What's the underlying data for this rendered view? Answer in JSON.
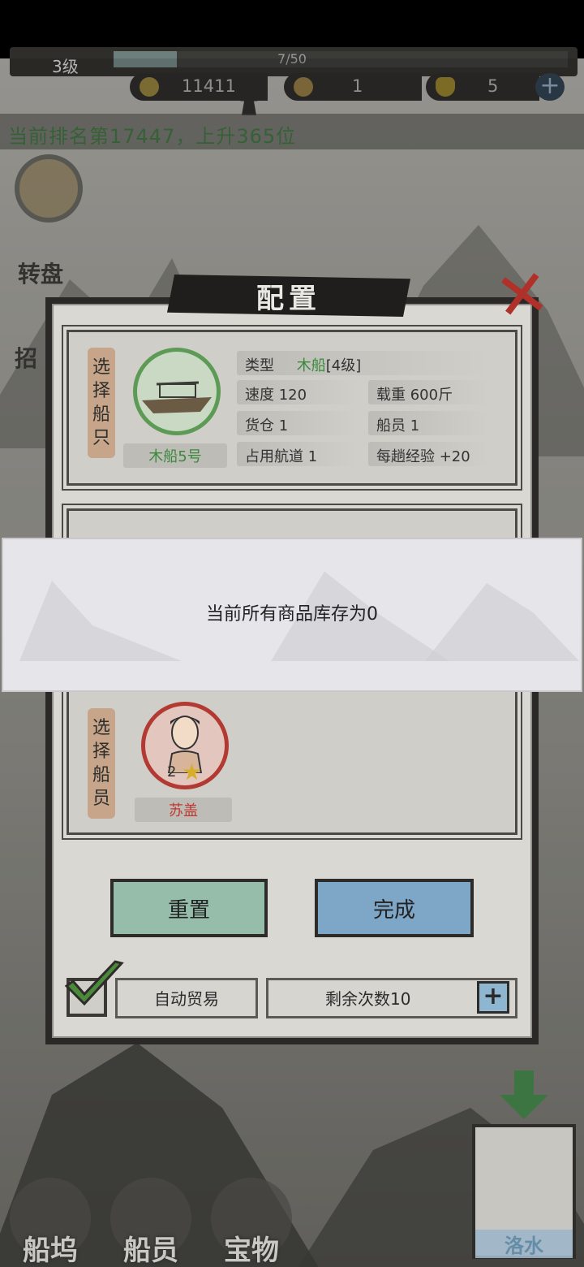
{
  "hud": {
    "level": "3级",
    "exp_text": "7/50",
    "exp_fraction": 0.14,
    "coins": "11411",
    "resource2": "1",
    "ingots": "5",
    "plus_label": "+",
    "rank_text": "当前排名第17447，上升365位"
  },
  "side": {
    "wheel_label": "转盘",
    "recruit_label": "招"
  },
  "dialog": {
    "title": "配置",
    "close_label": "✕",
    "ship_section_label": "选择船只",
    "ship": {
      "name": "木船5号",
      "type_label": "类型",
      "type_value": "木船",
      "type_level": "[4级]",
      "speed": "速度 120",
      "load": "载重 600斤",
      "cargo": "货仓 1",
      "crew": "船员 1",
      "lane": "占用航道 1",
      "exp": "每趟经验 +20"
    },
    "crew_section_label": "选择船员",
    "crew_member": {
      "name": "苏盖",
      "stars": "2"
    },
    "reset_label": "重置",
    "done_label": "完成",
    "auto_trade_label": "自动贸易",
    "remaining_label": "剩余次数10",
    "remaining_plus": "+"
  },
  "toast": {
    "message": "当前所有商品库存为0"
  },
  "nav": {
    "dock": "船坞",
    "crew": "船员",
    "treasure": "宝物",
    "map_label": "洛水"
  },
  "colors": {
    "ship_green": "#3a8a3a",
    "crew_red": "#c0382f",
    "reset_btn": "#95bdaa",
    "done_btn": "#7ea6c6"
  }
}
